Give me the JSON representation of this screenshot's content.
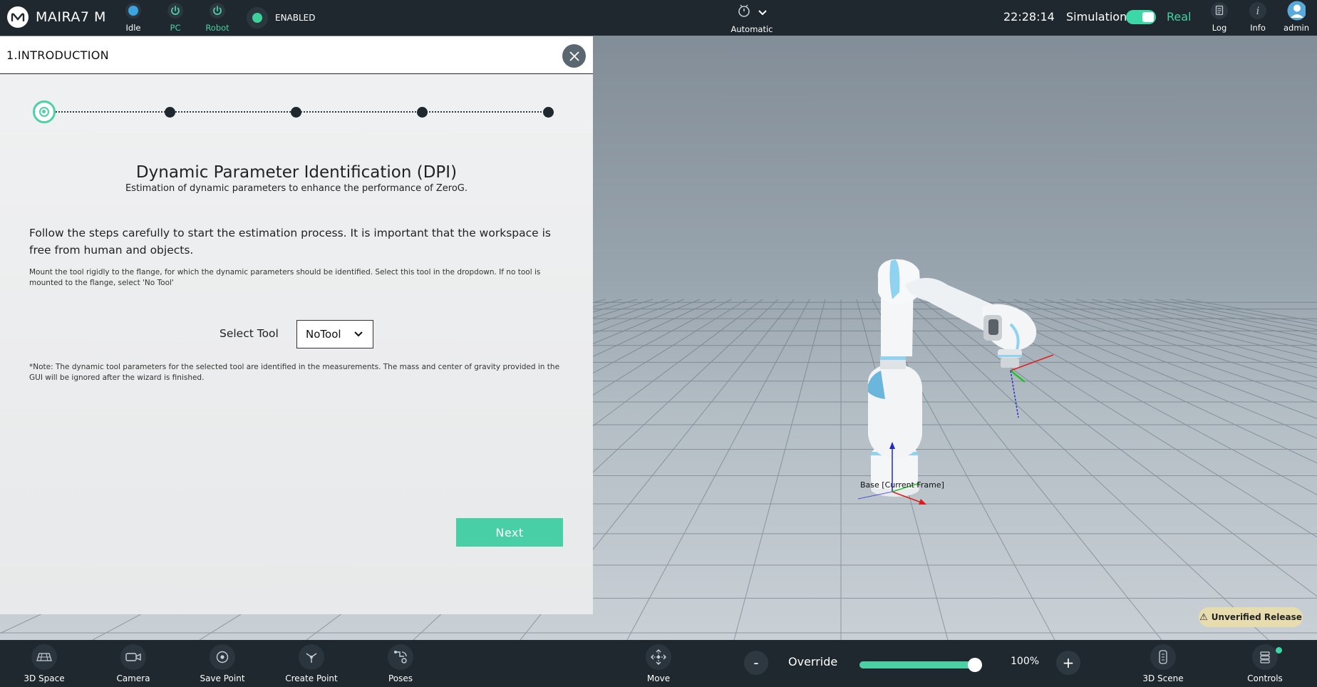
{
  "topbar": {
    "brand": "MAIRA7 M",
    "status_items": [
      {
        "label": "Idle",
        "color": "#3ba3e0"
      },
      {
        "label": "PC",
        "color": "#4ccfa3"
      },
      {
        "label": "Robot",
        "color": "#4ccfa3"
      }
    ],
    "enabled_label": "ENABLED",
    "mode_label": "Automatic",
    "clock": "22:28:14",
    "simulation_label": "Simulation",
    "real_label": "Real",
    "right_items": [
      {
        "label": "Log",
        "icon": "log-icon"
      },
      {
        "label": "Info",
        "icon": "info-icon"
      },
      {
        "label": "admin",
        "icon": "user-icon"
      }
    ]
  },
  "dialog": {
    "title": "1.INTRODUCTION",
    "steps_total": 5,
    "active_step": 1,
    "heading": "Dynamic Parameter Identification (DPI)",
    "subheading": "Estimation of dynamic parameters to enhance the performance of ZeroG.",
    "lead": "Follow the steps carefully to start the estimation process. It is important that the workspace is free from human and objects.",
    "instruction": "Mount the tool rigidly to the flange, for which the dynamic parameters should be identified. Select this tool in the dropdown. If no tool is mounted to the flange, select 'No Tool'",
    "select_label": "Select Tool",
    "select_value": "NoTool",
    "note": "*Note: The dynamic tool parameters for the selected tool are identified in the measurements. The mass and center of gravity provided in the GUI will be ignored after the wizard is finished.",
    "next_label": "Next"
  },
  "viewport": {
    "frame_label": "Base [Current Frame]",
    "unverified_label": "Unverified Release"
  },
  "bottombar": {
    "left_items": [
      {
        "label": "3D Space",
        "icon": "3d-space-icon"
      },
      {
        "label": "Camera",
        "icon": "camera-icon"
      },
      {
        "label": "Save Point",
        "icon": "save-point-icon"
      },
      {
        "label": "Create Point",
        "icon": "create-point-icon"
      },
      {
        "label": "Poses",
        "icon": "poses-icon"
      }
    ],
    "move_label": "Move",
    "override_label": "Override",
    "override_fraction": 1.0,
    "override_value": "100%",
    "minus_label": "-",
    "plus_label": "+",
    "scene_label": "3D Scene",
    "controls_label": "Controls"
  },
  "colors": {
    "accent": "#4ccfa6",
    "bar": "#1f282f",
    "idle_blue": "#3ba3e0"
  }
}
